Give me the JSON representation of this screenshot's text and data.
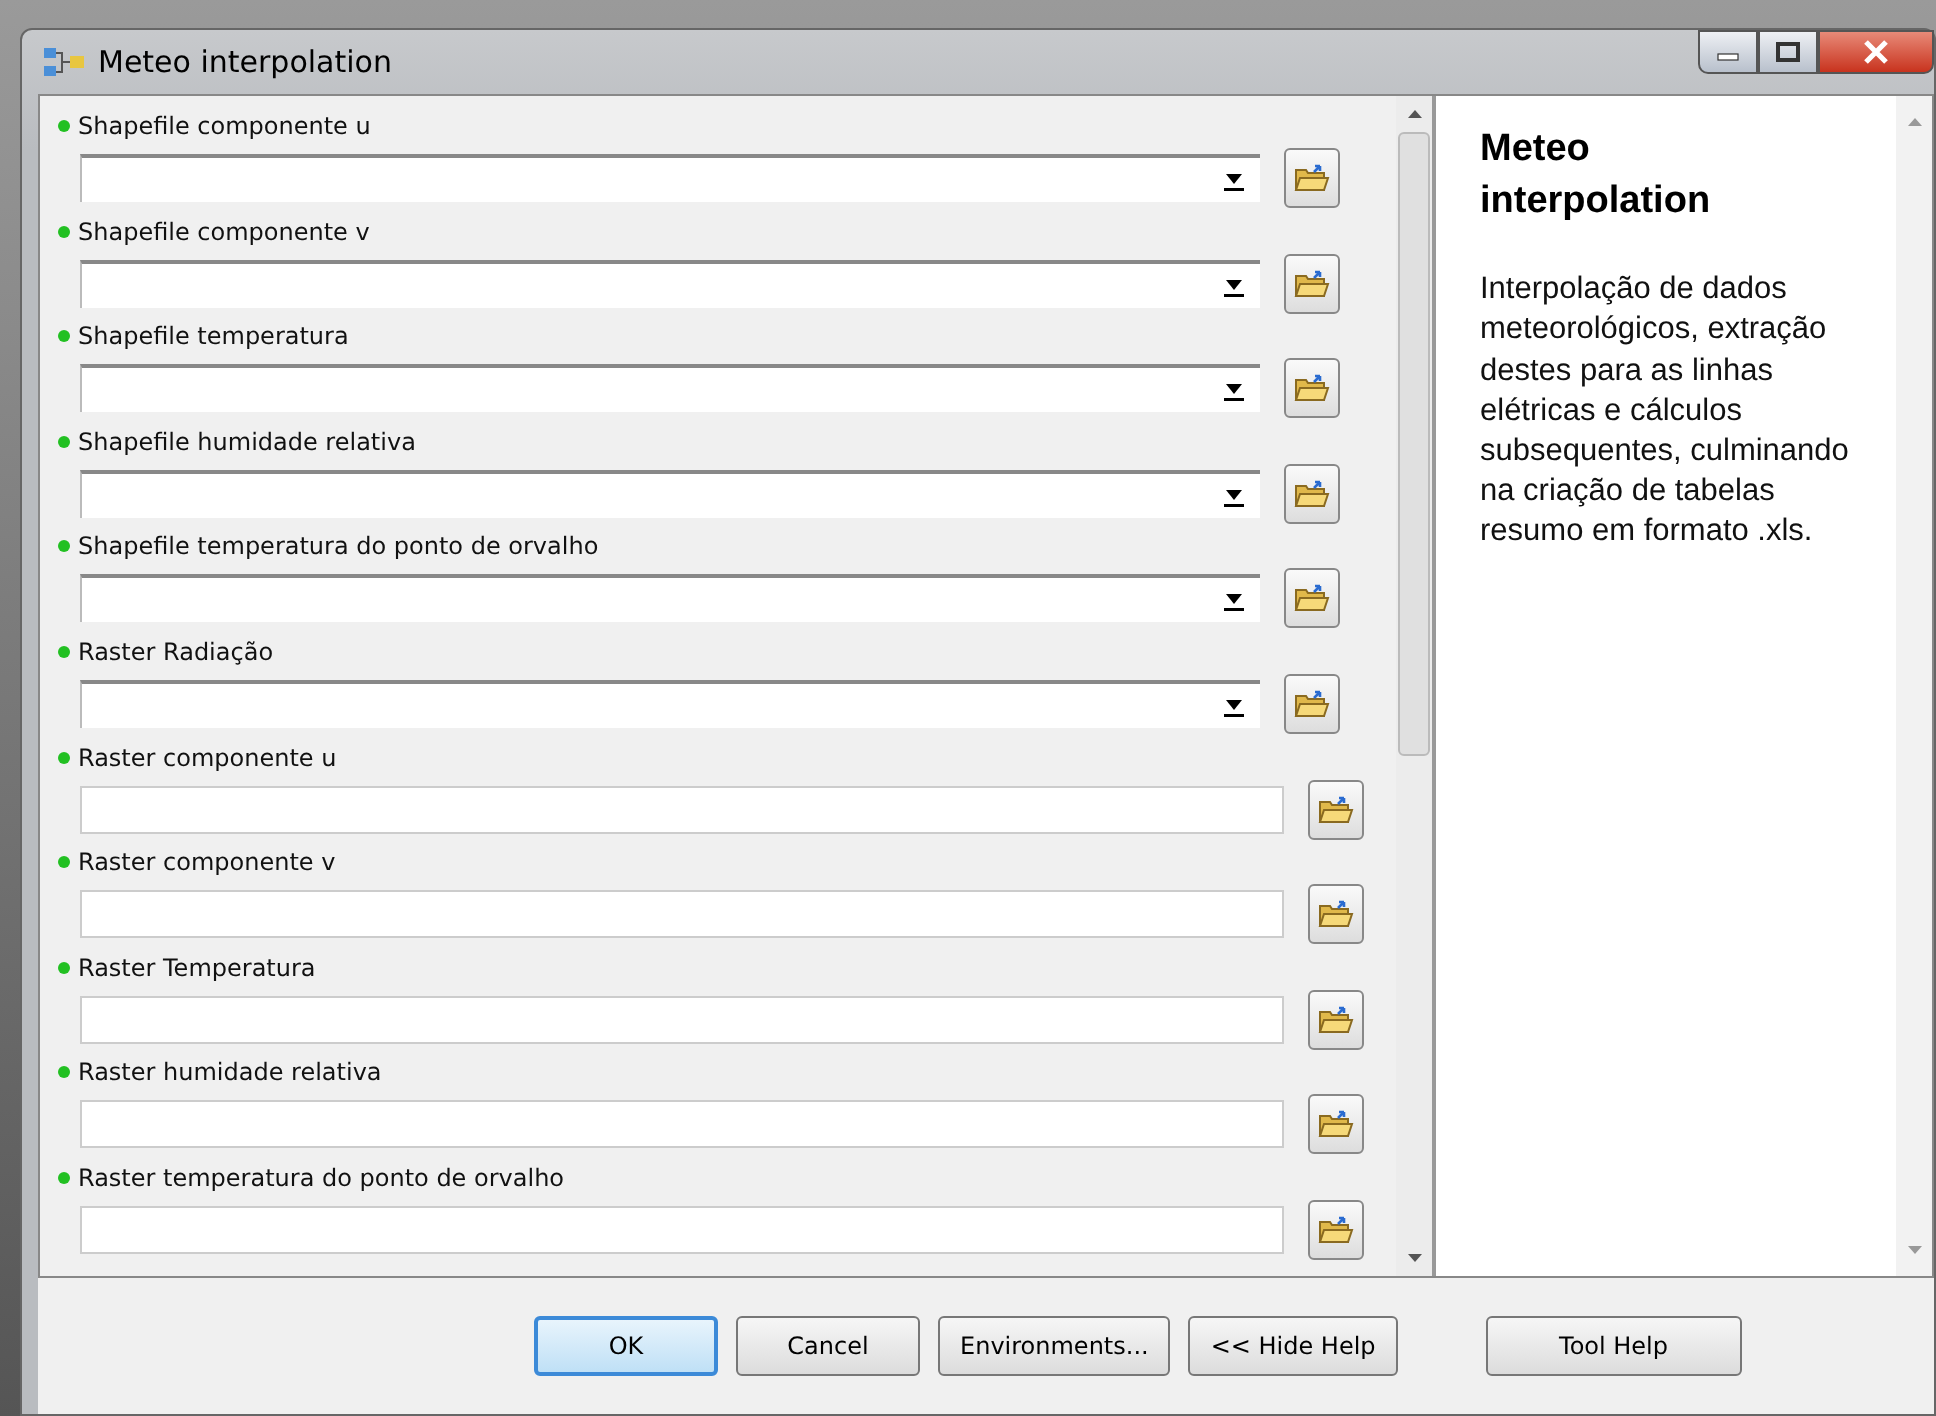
{
  "window": {
    "title": "Meteo interpolation"
  },
  "parameters": [
    {
      "label": "Shapefile componente u",
      "kind": "dropdown"
    },
    {
      "label": "Shapefile componente v",
      "kind": "dropdown"
    },
    {
      "label": "Shapefile temperatura",
      "kind": "dropdown"
    },
    {
      "label": "Shapefile humidade relativa",
      "kind": "dropdown"
    },
    {
      "label": "Shapefile temperatura do ponto de orvalho",
      "kind": "dropdown"
    },
    {
      "label": "Raster Radiação",
      "kind": "dropdown"
    },
    {
      "label": "Raster componente u",
      "kind": "text"
    },
    {
      "label": "Raster componente v",
      "kind": "text"
    },
    {
      "label": "Raster Temperatura",
      "kind": "text"
    },
    {
      "label": "Raster humidade relativa",
      "kind": "text"
    },
    {
      "label": "Raster temperatura do ponto de orvalho",
      "kind": "text"
    }
  ],
  "help": {
    "title": "Meteo interpolation",
    "text": "Interpolação de dados meteorológicos, extração destes para as linhas elétricas e cálculos subsequentes, culminando na criação de tabelas resumo em formato .xls."
  },
  "buttons": [
    {
      "label": "OK",
      "default": true
    },
    {
      "label": "Cancel",
      "default": false
    },
    {
      "label": "Environments...",
      "default": false
    },
    {
      "label": "<< Hide Help",
      "default": false
    },
    {
      "label": "Tool Help",
      "default": false
    }
  ]
}
